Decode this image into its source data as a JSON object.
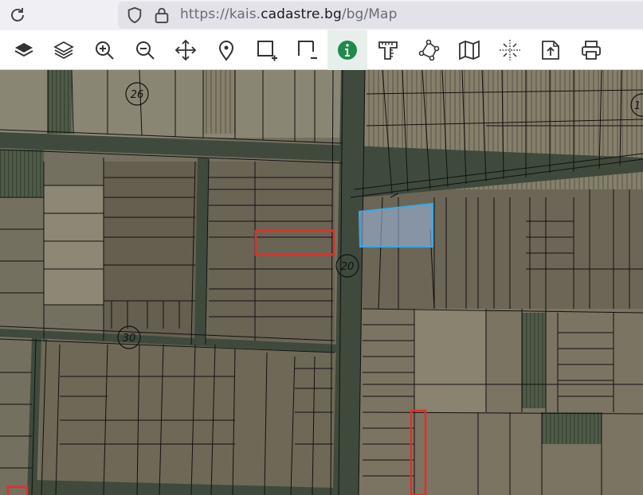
{
  "browser": {
    "url_prefix": "https://kais.",
    "url_host": "cadastre.bg",
    "url_path": "/bg/Map"
  },
  "toolbar": {
    "tools": [
      {
        "name": "base-layers-icon"
      },
      {
        "name": "layers-icon"
      },
      {
        "name": "zoom-in-icon"
      },
      {
        "name": "zoom-out-icon"
      },
      {
        "name": "pan-icon"
      },
      {
        "name": "location-pin-icon"
      },
      {
        "name": "select-add-icon"
      },
      {
        "name": "select-remove-icon"
      },
      {
        "name": "info-icon",
        "active": true
      },
      {
        "name": "measure-icon"
      },
      {
        "name": "polygon-nodes-icon"
      },
      {
        "name": "map-icon"
      },
      {
        "name": "coordinates-icon"
      },
      {
        "name": "export-icon"
      },
      {
        "name": "print-icon"
      }
    ],
    "accent_color": "#1f8a4c"
  },
  "map": {
    "road_labels": [
      "26",
      "20",
      "30",
      "1"
    ],
    "highlight_colors": {
      "selected": "#3aa8e6",
      "marked": "#e0302a"
    }
  }
}
